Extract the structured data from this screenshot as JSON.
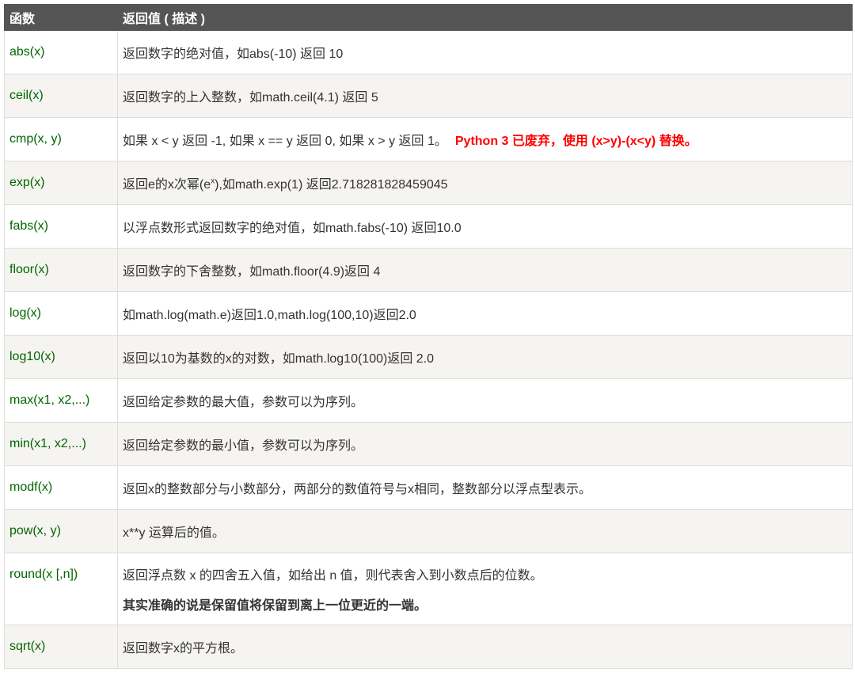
{
  "header": {
    "col1": "函数",
    "col2": "返回值 ( 描述 )"
  },
  "rows": [
    {
      "fn": "abs(x)",
      "desc": "返回数字的绝对值，如abs(-10) 返回 10"
    },
    {
      "fn": "ceil(x)",
      "desc": "返回数字的上入整数，如math.ceil(4.1) 返回 5"
    },
    {
      "fn": "cmp(x, y)",
      "desc": "如果 x < y 返回 -1, 如果 x == y 返回 0, 如果 x > y 返回 1。",
      "warn": "Python 3 已废弃，使用 (x>y)-(x<y) 替换。"
    },
    {
      "fn": "exp(x)",
      "desc_pre": "返回e的x次幂(e",
      "desc_sup": "x",
      "desc_post": "),如math.exp(1) 返回2.718281828459045"
    },
    {
      "fn": "fabs(x)",
      "desc": "以浮点数形式返回数字的绝对值，如math.fabs(-10) 返回10.0"
    },
    {
      "fn": "floor(x)",
      "desc": "返回数字的下舍整数，如math.floor(4.9)返回 4"
    },
    {
      "fn": "log(x)",
      "desc": "如math.log(math.e)返回1.0,math.log(100,10)返回2.0"
    },
    {
      "fn": "log10(x)",
      "desc": "返回以10为基数的x的对数，如math.log10(100)返回 2.0"
    },
    {
      "fn": "max(x1, x2,...)",
      "desc": "返回给定参数的最大值，参数可以为序列。"
    },
    {
      "fn": "min(x1, x2,...)",
      "desc": "返回给定参数的最小值，参数可以为序列。"
    },
    {
      "fn": "modf(x)",
      "desc": "返回x的整数部分与小数部分，两部分的数值符号与x相同，整数部分以浮点型表示。"
    },
    {
      "fn": "pow(x, y)",
      "desc": "x**y 运算后的值。"
    },
    {
      "fn": "round(x [,n])",
      "desc": "返回浮点数 x 的四舍五入值，如给出 n 值，则代表舍入到小数点后的位数。",
      "note": "其实准确的说是保留值将保留到离上一位更近的一端。"
    },
    {
      "fn": "sqrt(x)",
      "desc": "返回数字x的平方根。"
    }
  ]
}
